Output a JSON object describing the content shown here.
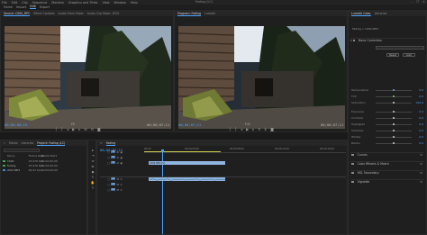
{
  "menubar": {
    "items": [
      "File",
      "Edit",
      "Clip",
      "Sequence",
      "Markers",
      "Graphics and Titles",
      "View",
      "Window",
      "Help"
    ],
    "title": "Fading (LC)",
    "controls": [
      "–",
      "☐",
      "✕"
    ]
  },
  "workspaces": {
    "items": [
      "Home",
      "Import",
      "Edit",
      "Export"
    ],
    "active_index": 2
  },
  "source_monitor": {
    "tabs": [
      "Source: CS00_RPC",
      "Effect Controls",
      "Audio Track Mixer",
      "Audio Clip Mixer: LP02"
    ],
    "timecode_left": "00;00;00;13",
    "timecode_right": "00;00;07;11",
    "fit": "Fit"
  },
  "program_monitor": {
    "tabs": [
      "Program: Fading",
      "Lumetri"
    ],
    "timecode_left": "00;00;07;11",
    "timecode_right": "00;00;07;11",
    "fit": "Full"
  },
  "lumetri": {
    "tabs": [
      "Lumetri Color",
      "Libraries"
    ],
    "header": "Fading > LP02.MP4",
    "basic_correction": "Basic Correction",
    "sliders": [
      {
        "label": "Temperature",
        "value": "0.0",
        "pos": 0.5,
        "color": "#6aa1e8"
      },
      {
        "label": "Tint",
        "value": "0.0",
        "pos": 0.5,
        "color": "#7ed05c"
      },
      {
        "label": "Saturation",
        "value": "100.0",
        "pos": 0.5,
        "color": "#cfcfcf"
      },
      {
        "label": "Exposure",
        "value": "0.0",
        "pos": 0.5,
        "color": "#cfcfcf"
      },
      {
        "label": "Contrast",
        "value": "0.0",
        "pos": 0.5,
        "color": "#cfcfcf"
      },
      {
        "label": "Highlights",
        "value": "0.0",
        "pos": 0.5,
        "color": "#cfcfcf"
      },
      {
        "label": "Shadows",
        "value": "0.0",
        "pos": 0.5,
        "color": "#cfcfcf"
      },
      {
        "label": "Whites",
        "value": "0.0",
        "pos": 0.5,
        "color": "#cfcfcf"
      },
      {
        "label": "Blacks",
        "value": "0.0",
        "pos": 0.5,
        "color": "#cfcfcf"
      }
    ],
    "reset_label": "Reset",
    "auto_label": "Auto",
    "sections": [
      "Curves",
      "Color Wheels & Match",
      "HSL Secondary",
      "Vignette"
    ]
  },
  "project": {
    "tabs": [
      "Project: Fading (LC)",
      "Media",
      "Libraries",
      "Info"
    ],
    "search_placeholder": "",
    "columns": [
      "Name",
      "Frame Rate",
      "Media Start"
    ],
    "items": [
      {
        "name": "CS00",
        "rate": "23.976 fps",
        "start": "00;00;00;00",
        "color": "#35a852"
      },
      {
        "name": "Fading",
        "rate": "23.976 fps",
        "start": "00;00;00;00",
        "color": "#35a852"
      },
      {
        "name": "LP02.MP4",
        "rate": "29.97 fps",
        "start": "00;00;00;00",
        "color": "#4a87d6"
      }
    ]
  },
  "timeline": {
    "tab": "Fading",
    "timecode": "00;00;07;11",
    "ruler_labels": [
      "00;00",
      "00;00;04;00",
      "00;00;08;00",
      "00;00;12;00",
      "00;00;16;00"
    ],
    "video_tracks": [
      "V3",
      "V2",
      "V1"
    ],
    "audio_tracks": [
      "A1",
      "A2",
      "A3"
    ],
    "clips": [
      {
        "label": "LP02.MP4 [V]",
        "color": "#8fb5de",
        "track": "V1"
      },
      {
        "label": "",
        "color": "#8fb5de",
        "track": "A1"
      }
    ]
  },
  "tools": [
    "▸",
    "⇥",
    "⇔",
    "⇋",
    "◆",
    "✎",
    "✋",
    "T"
  ]
}
